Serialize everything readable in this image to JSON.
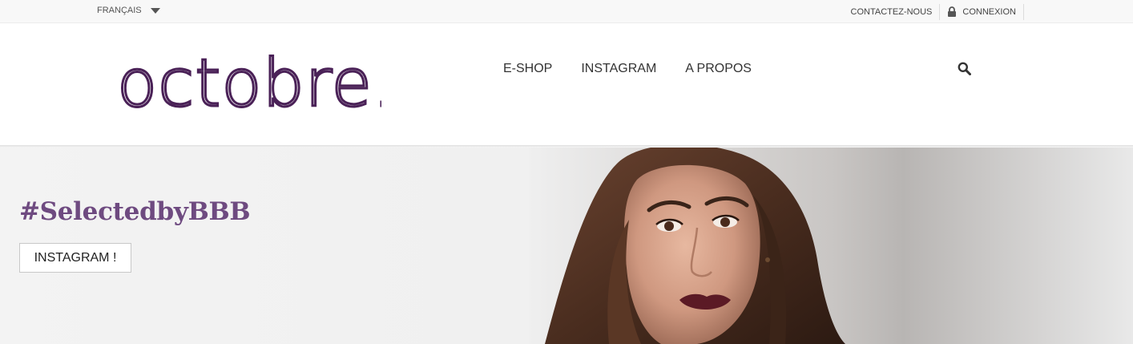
{
  "topbar": {
    "language": "FRANÇAIS",
    "contact_label": "CONTACTEZ-NOUS",
    "login_label": "CONNEXION"
  },
  "header": {
    "logo_text": "octobre.",
    "nav": [
      {
        "label": "E-SHOP"
      },
      {
        "label": "INSTAGRAM"
      },
      {
        "label": "A PROPOS"
      }
    ],
    "search_icon": "search-icon"
  },
  "hero": {
    "title": "#SelectedbyBBB",
    "button_label": "INSTAGRAM !"
  },
  "colors": {
    "brand_purple": "#4a2157",
    "hero_title": "#6e4a80",
    "topbar_bg": "#f8f8f8"
  }
}
